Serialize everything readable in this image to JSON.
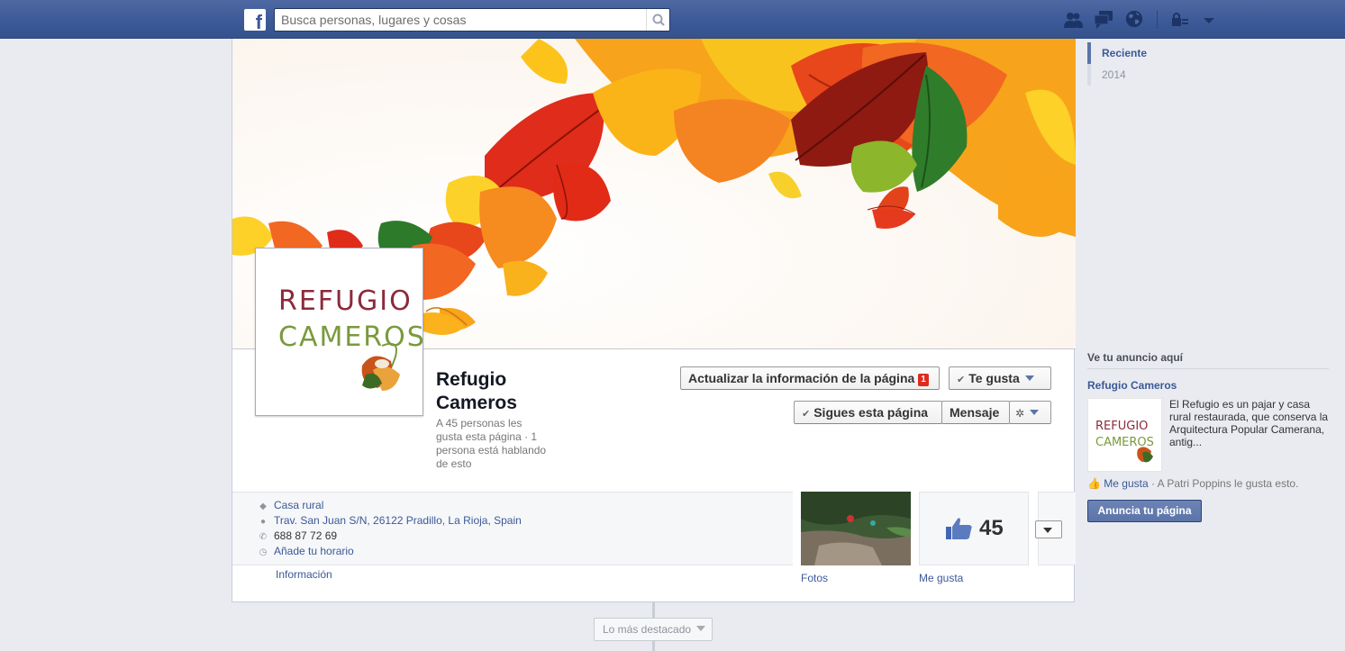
{
  "topbar": {
    "search_placeholder": "Busca personas, lugares y cosas",
    "icons": [
      "facebook-logo",
      "search-icon",
      "friend-requests-icon",
      "messages-icon",
      "notifications-globe-icon",
      "privacy-lock-icon",
      "account-menu-caret-icon"
    ]
  },
  "page": {
    "name": "Refugio Cameros",
    "likes_text": "A 45 personas les gusta esta página · 1 persona está hablando de esto",
    "logo_line1": "REFUGIO",
    "logo_line2": "CAMEROS"
  },
  "actions": {
    "update_info": "Actualizar la información de la página",
    "update_badge": "1",
    "like_label": "Te gusta",
    "following_label": "Sigues esta página",
    "message_label": "Mensaje"
  },
  "info": {
    "category": "Casa rural",
    "address": "Trav. San Juan S/N, 26122 Pradillo, La Rioja, Spain",
    "phone": "688 87 72 69",
    "hours": "Añade tu horario",
    "tab_info": "Información"
  },
  "tiles": {
    "photos_label": "Fotos",
    "likes_count": "45",
    "likes_label": "Me gusta"
  },
  "timeline": {
    "highlight_label": "Lo más destacado",
    "years": [
      {
        "label": "Reciente",
        "active": true
      },
      {
        "label": "2014",
        "active": false
      }
    ]
  },
  "ads": {
    "header": "Ve tu anuncio aquí",
    "title": "Refugio Cameros",
    "description": "El Refugio es un pajar y casa rural restaurada, que conserva la Arquitectura Popular Camerana, antig...",
    "like_link": "Me gusta",
    "like_text": " · A Patri Poppins le gusta esto.",
    "promote_button": "Anuncia tu página",
    "logo_line1": "REFUGIO",
    "logo_line2": "CAMEROS"
  },
  "colors": {
    "brand_blue": "#3b5998",
    "badge_red": "#e02a1d",
    "logo_red": "#8c2a3a",
    "logo_green": "#7a9a3c"
  }
}
